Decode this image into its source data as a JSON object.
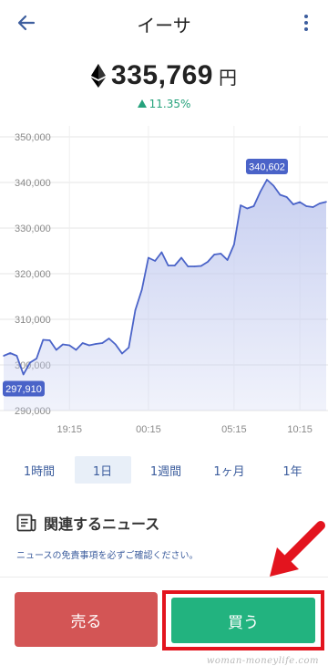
{
  "header": {
    "title": "イーサ",
    "back_icon": "arrow-left-icon",
    "menu_icon": "more-vert-icon"
  },
  "price": {
    "icon": "ethereum-icon",
    "value": "335,769",
    "unit": "円",
    "change": "11.35%",
    "change_color": "#26a27c"
  },
  "chart_data": {
    "type": "area",
    "title": "",
    "xlabel": "",
    "ylabel": "",
    "ylim": [
      290000,
      350000
    ],
    "y_ticks": [
      "290,000",
      "300,000",
      "310,000",
      "320,000",
      "330,000",
      "340,000",
      "350,000"
    ],
    "x_ticks": [
      "19:15",
      "00:15",
      "05:15",
      "10:15"
    ],
    "x_tick_index": [
      10,
      22,
      35,
      45
    ],
    "series": [
      {
        "values": [
          302000,
          302600,
          302000,
          297910,
          300500,
          301400,
          305500,
          305400,
          303300,
          304500,
          304300,
          303300,
          304800,
          304300,
          304600,
          304800,
          305800,
          304500,
          302500,
          303800,
          312000,
          316500,
          323500,
          322800,
          324700,
          321800,
          321800,
          323500,
          321600,
          321600,
          321700,
          322600,
          324200,
          324400,
          323000,
          326400,
          335000,
          334300,
          334800,
          338000,
          340602,
          339300,
          337300,
          336800,
          335200,
          335700,
          334800,
          334600,
          335400,
          335769
        ]
      }
    ],
    "annotations": [
      {
        "label": "297,910",
        "index": 3
      },
      {
        "label": "340,602",
        "index": 40
      }
    ],
    "line_color": "#4a63c8",
    "fill_color": "#c5cdf0",
    "grid": true
  },
  "periods": [
    {
      "label": "1時間",
      "active": false
    },
    {
      "label": "1日",
      "active": true
    },
    {
      "label": "1週間",
      "active": false
    },
    {
      "label": "1ヶ月",
      "active": false
    },
    {
      "label": "1年",
      "active": false
    }
  ],
  "news": {
    "icon": "news-document-icon",
    "title": "関連するニュース",
    "note": "ニュースの免責事項を必ずご確認ください。"
  },
  "actions": {
    "sell_label": "売る",
    "buy_label": "買う",
    "sell_color": "#d35555",
    "buy_color": "#22b37f",
    "highlight_color": "#e3141e"
  },
  "watermark": "woman-moneylife.com"
}
